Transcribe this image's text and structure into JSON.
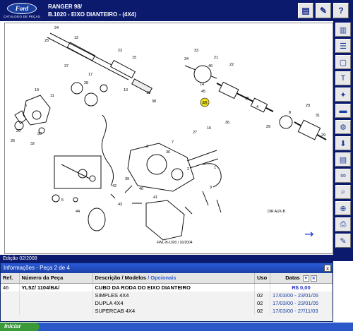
{
  "header": {
    "logo_text": "Ford",
    "logo_subtitle": "CATÁLOGO DE PEÇAS",
    "model": "RANGER 98/",
    "section": "B.1020 - EIXO DIANTEIRO - (4X4)"
  },
  "diagram": {
    "callouts": [
      "24",
      "25",
      "12",
      "23",
      "15",
      "28",
      "37",
      "17",
      "10",
      "18",
      "38",
      "19",
      "11",
      "6",
      "20",
      "30",
      "26",
      "32",
      "33",
      "34",
      "45",
      "46",
      "21",
      "14",
      "22",
      "35",
      "29",
      "8",
      "29",
      "31",
      "29",
      "4",
      "36",
      "16",
      "27",
      "7",
      "36",
      "3",
      "2",
      "1",
      "9",
      "39",
      "40",
      "41",
      "42",
      "43",
      "44",
      "5"
    ],
    "highlighted_callout": "46",
    "figure_code": "FWL-B-1020 / 16/2004",
    "corner_note": "DIR\nAUX-B",
    "nav_arrow": "→"
  },
  "edition": "Edição 02/2008",
  "info_panel": {
    "title": "Informações - Peça 2 de 4",
    "close": "x",
    "columns": {
      "ref": "Ref.",
      "part": "Número da Peça",
      "desc": "Descrição /",
      "desc_models": "Modelos",
      "desc_opt": "/ Opcionais",
      "uso": "Uso",
      "datas": "Datas"
    },
    "rows": [
      {
        "ref": "46",
        "part": "YL5Z/   1104/BA/",
        "desc": "CUBO DA RODA DO EIXO DIANTEIRO",
        "uso": "",
        "datas": "R$ 0,00"
      },
      {
        "ref": "",
        "part": "",
        "desc": "SIMPLES 4X4",
        "uso": "02",
        "datas": "17/03/00 - 23/01/05"
      },
      {
        "ref": "",
        "part": "",
        "desc": "DUPLA 4X4",
        "uso": "02",
        "datas": "17/03/00 - 23/01/05"
      },
      {
        "ref": "",
        "part": "",
        "desc": "SUPERCAB 4X4",
        "uso": "02",
        "datas": "17/03/00 - 27/11/03"
      }
    ]
  },
  "taskbar": {
    "start_label": "Iniciar"
  },
  "colors": {
    "header_bg": "#0c1a6e",
    "price": "#2330c8",
    "highlight": "#f0e020"
  }
}
